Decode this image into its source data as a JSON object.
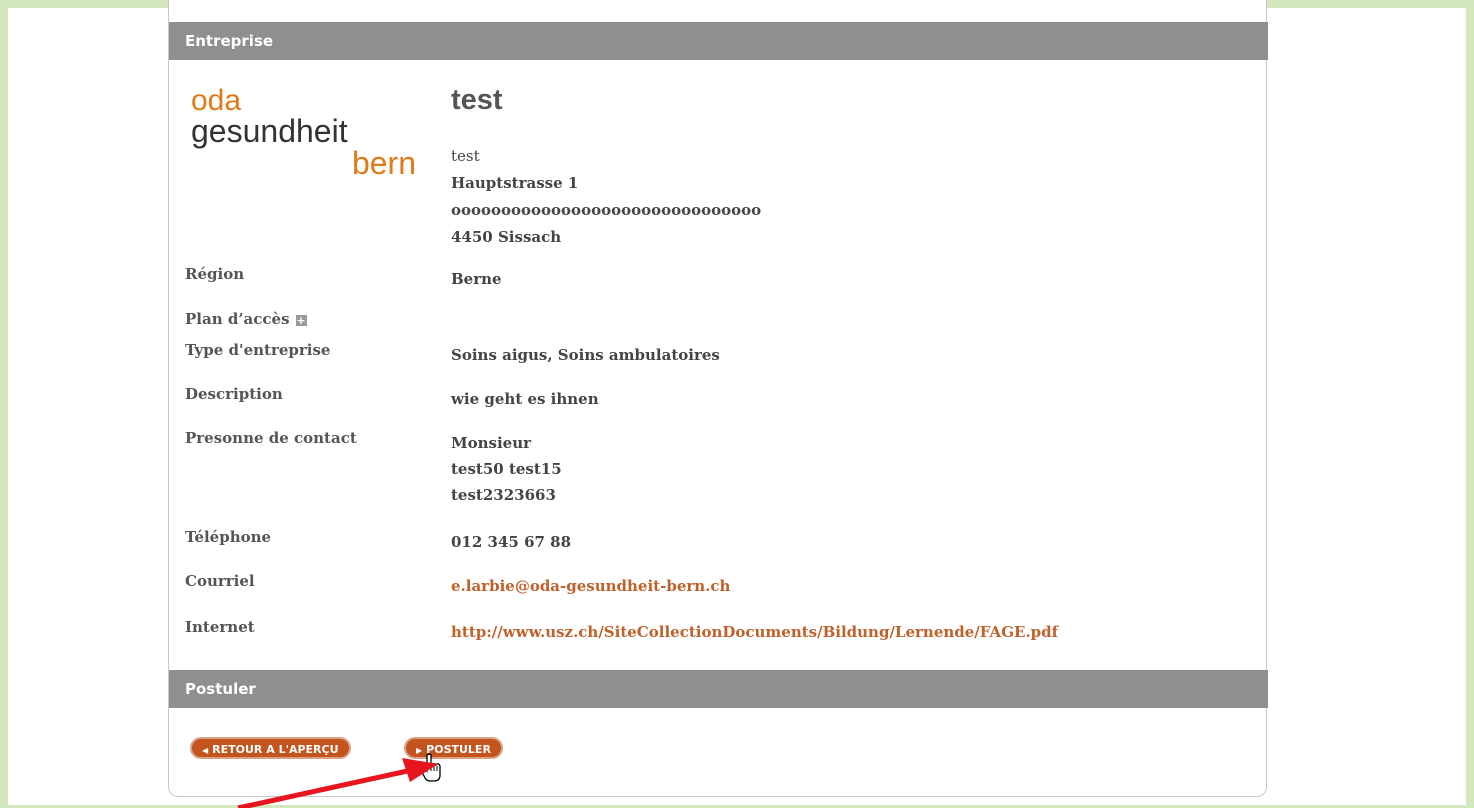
{
  "sections": {
    "company_header": "Entreprise",
    "apply_header": "Postuler"
  },
  "logo": {
    "line1": "oda",
    "line2": "gesundheit",
    "line3": "bern"
  },
  "company": {
    "name": "test",
    "address": [
      "test",
      "Hauptstrasse 1",
      "ooooooooooooooooooooooooooooooo",
      "4450 Sissach"
    ]
  },
  "fields": {
    "region": {
      "label": "Région",
      "value": "Berne"
    },
    "access_plan": {
      "label": "Plan d’accès"
    },
    "company_type": {
      "label": "Type d'entreprise",
      "value": "Soins aigus, Soins ambulatoires"
    },
    "description": {
      "label": "Description",
      "value": "wie geht es ihnen"
    },
    "contact": {
      "label": "Presonne de contact",
      "lines": [
        "Monsieur",
        "test50 test15",
        "test2323663"
      ]
    },
    "phone": {
      "label": "Téléphone",
      "value": "012 345 67 88"
    },
    "email": {
      "label": "Courriel",
      "value": "e.larbie@oda-gesundheit-bern.ch"
    },
    "internet": {
      "label": "Internet",
      "value": "http://www.usz.ch/SiteCollectionDocuments/Bildung/Lernende/FAGE.pdf"
    }
  },
  "buttons": {
    "back": "RETOUR A L'APERÇU",
    "apply": "POSTULER"
  },
  "icons": {
    "back": "triangle-left-icon",
    "apply": "triangle-right-icon",
    "plan": "plus-icon",
    "pointer": "hand-pointer-icon",
    "annotation": "red-arrow-icon"
  },
  "colors": {
    "frame": "#d4e8c0",
    "header": "#8f8f8f",
    "button": "#c4541e",
    "link": "#c0602a",
    "logo_orange": "#e07a1a",
    "annotation": "#e8141e"
  }
}
